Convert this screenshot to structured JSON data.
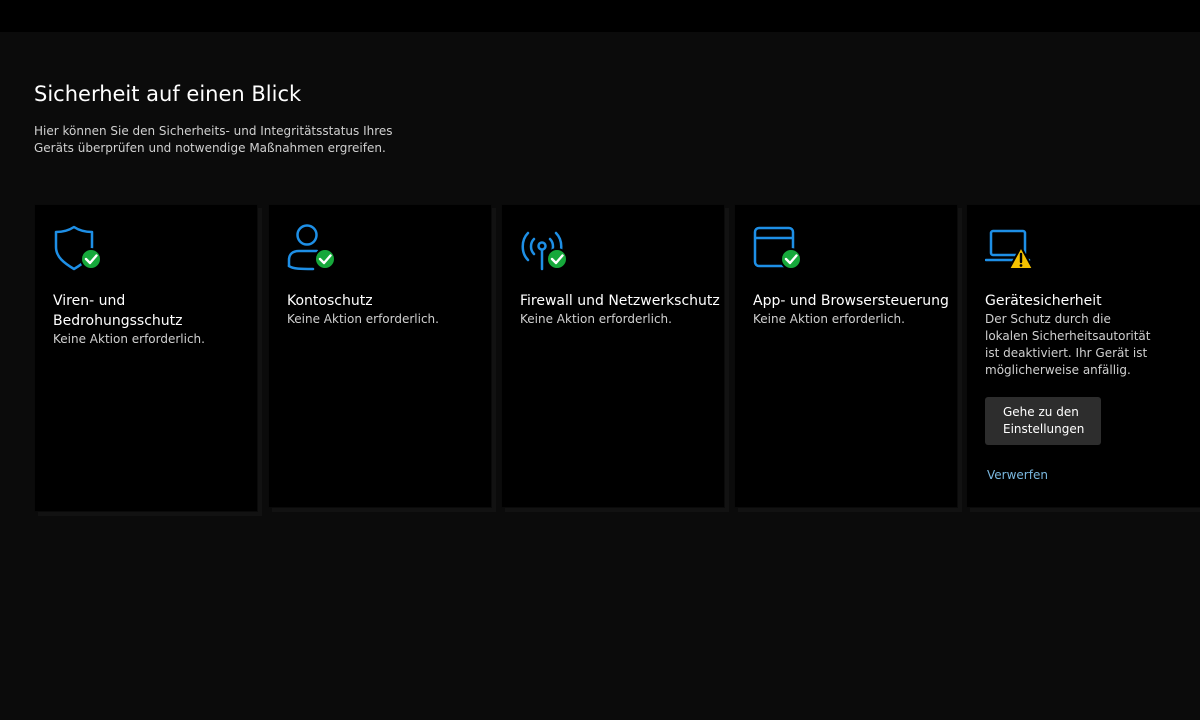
{
  "header": {
    "title": "Sicherheit auf einen Blick",
    "description": "Hier können Sie den Sicherheits- und Integritätsstatus Ihres Geräts überprüfen und notwendige Maßnahmen ergreifen."
  },
  "colors": {
    "accent": "#1e8fe6",
    "ok": "#16a83b",
    "warning": "#f5c200",
    "link": "#7ab8e0"
  },
  "cards": [
    {
      "icon": "shield-icon",
      "badge": "check-badge-icon",
      "title": "Viren- und Bedrohungsschutz",
      "status": "Keine Aktion erforderlich."
    },
    {
      "icon": "person-icon",
      "badge": "check-badge-icon",
      "title": "Kontoschutz",
      "status": "Keine Aktion erforderlich."
    },
    {
      "icon": "wifi-antenna-icon",
      "badge": "check-badge-icon",
      "title": "Firewall und Netzwerkschutz",
      "status": "Keine Aktion erforderlich."
    },
    {
      "icon": "browser-window-icon",
      "badge": "check-badge-icon",
      "title": "App- und Browsersteuerung",
      "status": "Keine Aktion erforderlich."
    },
    {
      "icon": "laptop-icon",
      "badge": "warning-badge-icon",
      "title": "Gerätesicherheit",
      "status": "Der Schutz durch die lokalen Sicherheitsautorität ist deaktiviert. Ihr Gerät ist möglicherweise anfällig.",
      "button_label": "Gehe zu den Einstellungen",
      "link_label": "Verwerfen"
    }
  ]
}
